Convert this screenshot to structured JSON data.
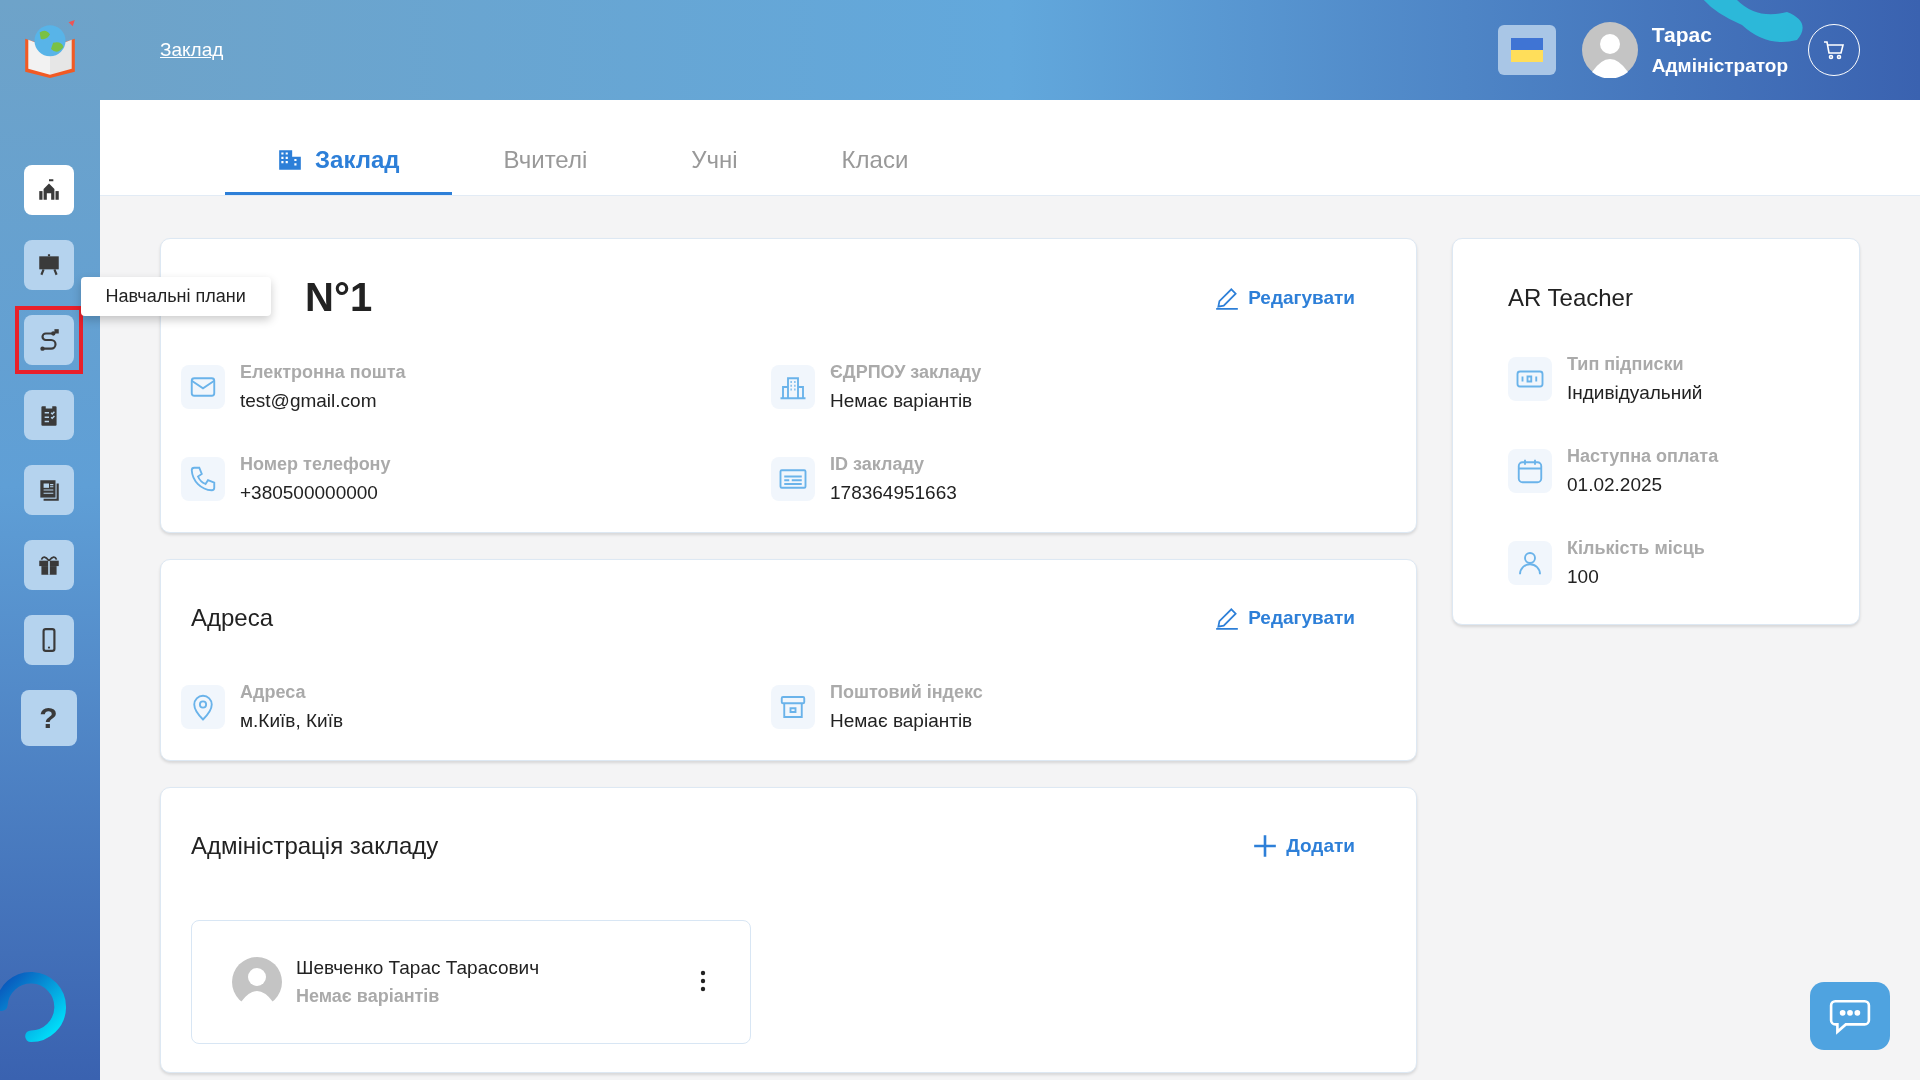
{
  "header": {
    "breadcrumb": "Заклад",
    "user": {
      "name": "Тарас",
      "role": "Адміністратор"
    }
  },
  "sidebar": {
    "items": [
      {
        "selected": true,
        "highlighted": false
      },
      {
        "selected": false,
        "highlighted": false
      },
      {
        "selected": false,
        "highlighted": true,
        "tooltip": "Навчальні плани"
      },
      {
        "selected": false,
        "highlighted": false
      },
      {
        "selected": false,
        "highlighted": false
      },
      {
        "selected": false,
        "highlighted": false
      },
      {
        "selected": false,
        "highlighted": false
      },
      {
        "selected": false,
        "highlighted": false,
        "label": "?"
      }
    ]
  },
  "tabs": [
    {
      "label": "Заклад",
      "selected": true
    },
    {
      "label": "Вчителі",
      "selected": false
    },
    {
      "label": "Учні",
      "selected": false
    },
    {
      "label": "Класи",
      "selected": false
    }
  ],
  "school_card": {
    "title": "N°1",
    "action": "Редагувати",
    "fields": [
      {
        "label": "Електронна пошта",
        "value": "test@gmail.com"
      },
      {
        "label": "ЄДРПОУ закладу",
        "value": "Немає варіантів"
      },
      {
        "label": "Номер телефону",
        "value": "+380500000000"
      },
      {
        "label": "ID закладу",
        "value": "178364951663"
      }
    ]
  },
  "address_card": {
    "title": "Адреса",
    "action": "Редагувати",
    "fields": [
      {
        "label": "Адреса",
        "value": "м.Київ, Київ"
      },
      {
        "label": "Поштовий індекс",
        "value": "Немає варіантів"
      }
    ]
  },
  "admin_card": {
    "title": "Адміністрація закладу",
    "action": "Додати",
    "members": [
      {
        "name": "Шевченко Тарас Тарасович",
        "subtitle": "Немає варіантів"
      }
    ]
  },
  "subscription": {
    "title": "AR Teacher",
    "fields": [
      {
        "label": "Тип підписки",
        "value": "Індивідуальний"
      },
      {
        "label": "Наступна оплата",
        "value": "01.02.2025"
      },
      {
        "label": "Кількість місць",
        "value": "100"
      }
    ]
  }
}
